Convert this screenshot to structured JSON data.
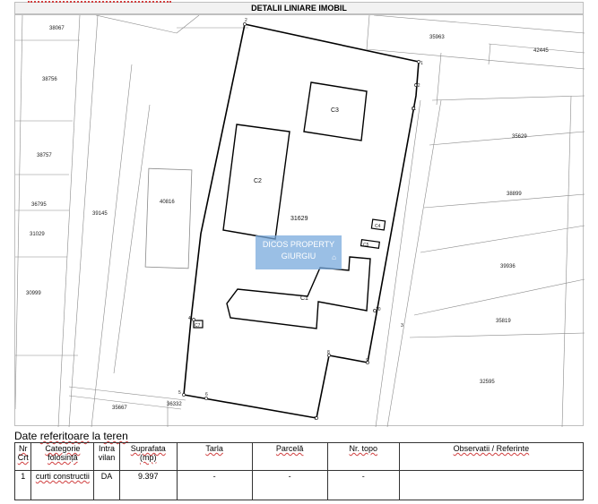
{
  "header": {
    "title": "DETALII LINIARE IMOBIL"
  },
  "map": {
    "parcels": [
      "38067",
      "35963",
      "42445",
      "38756",
      "35629",
      "38757",
      "38899",
      "36795",
      "39145",
      "40816",
      "31029",
      "39936",
      "30999",
      "35819",
      "32595",
      "35667",
      "36332"
    ],
    "main_parcel": "31629",
    "buildings": [
      "C1",
      "C2",
      "C3",
      "C4",
      "C5",
      "C7"
    ],
    "vertices": [
      "1",
      "2",
      "3",
      "4",
      "5",
      "6",
      "7",
      "8",
      "9",
      "10",
      "11",
      "12"
    ],
    "watermark": {
      "line1": "DICOS PROPERTY",
      "line2": "GIURGIU",
      "icon": "logo-icon"
    }
  },
  "section": {
    "prefix": "Date ",
    "underlined": "referitoare",
    "suffix": " la ",
    "last": "teren"
  },
  "table": {
    "headers": {
      "nr": "Nr Crt",
      "categorie": "Categorie folosință",
      "intra": "Intra vilan",
      "suprafata": "Suprafata (mp)",
      "tarla": "Tarla",
      "parcela": "Parcelă",
      "topo": "Nr. topo",
      "obs": "Observatii / Referinte"
    },
    "row": {
      "nr": "1",
      "categorie": "curti constructii",
      "intra": "DA",
      "suprafata": "9.397",
      "tarla": "-",
      "parcela": "-",
      "topo": "-",
      "obs": ""
    }
  }
}
